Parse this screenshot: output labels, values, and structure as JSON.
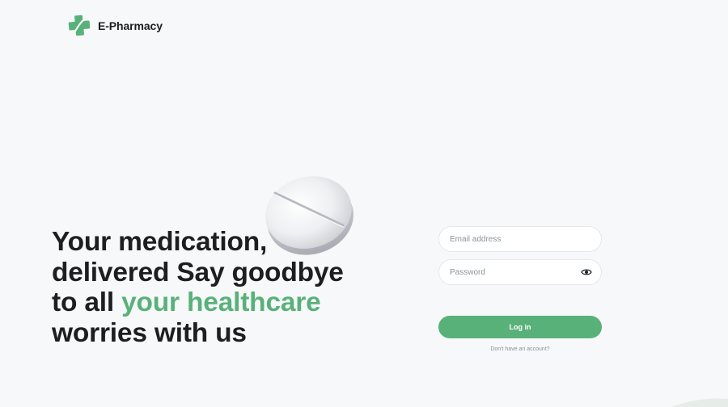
{
  "brand": {
    "name": "E-Pharmacy",
    "logo_icon": "medical-cross-logo-icon",
    "logo_color": "#59b17a"
  },
  "hero": {
    "line1": "Your medication,",
    "line2": "delivered Say goodbye",
    "line3_prefix": "to all ",
    "line3_accent": "your healthcare",
    "line4": "worries with us",
    "accent_color": "#59b17a"
  },
  "decor": {
    "pill_icon": "pill-tablet-icon"
  },
  "login_form": {
    "email_placeholder": "Email address",
    "email_value": "",
    "password_placeholder": "Password",
    "password_value": "",
    "toggle_icon": "eye-icon",
    "login_label": "Log in",
    "signup_link": "Don't have an account?",
    "button_color": "#59b17a"
  }
}
